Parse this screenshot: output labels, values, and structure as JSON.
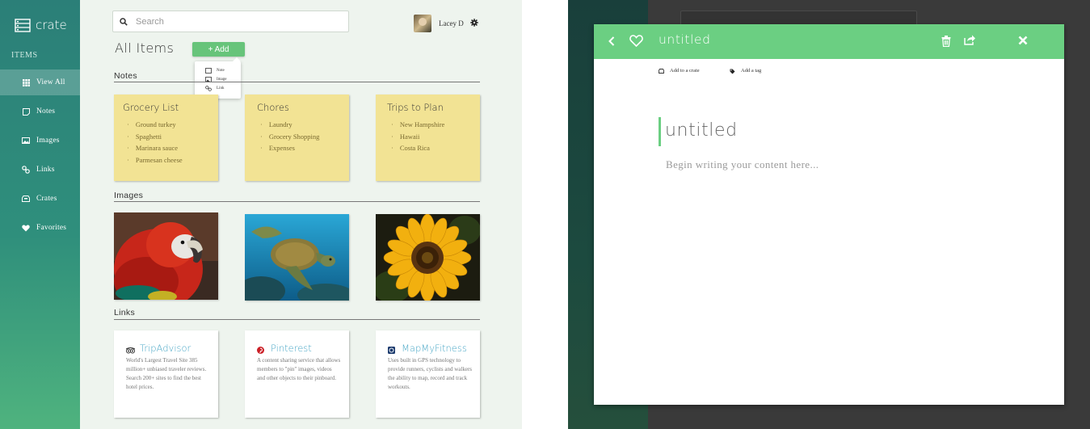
{
  "app": {
    "brand": "crate"
  },
  "sidebar": {
    "heading": "ITEMS",
    "items": [
      {
        "label": "View All",
        "icon": "grid-icon",
        "active": true
      },
      {
        "label": "Notes",
        "icon": "note-icon"
      },
      {
        "label": "Images",
        "icon": "image-icon"
      },
      {
        "label": "Links",
        "icon": "link-icon"
      },
      {
        "label": "Crates",
        "icon": "crate-icon"
      },
      {
        "label": "Favorites",
        "icon": "heart-icon"
      }
    ]
  },
  "search": {
    "placeholder": "Search"
  },
  "user": {
    "name": "Lacey D"
  },
  "main": {
    "title": "All Items",
    "add_label": "+ Add",
    "add_menu": [
      "Note",
      "Image",
      "Link"
    ],
    "sections": {
      "notes": "Notes",
      "images": "Images",
      "links": "Links"
    },
    "notes": [
      {
        "title": "Grocery List",
        "items": [
          "Ground turkey",
          "Spaghetti",
          "Marinara sauce",
          "Parmesan cheese"
        ]
      },
      {
        "title": "Chores",
        "items": [
          "Laundry",
          "Grocery Shopping",
          "Expenses"
        ]
      },
      {
        "title": "Trips to Plan",
        "items": [
          "New Hampshire",
          "Hawaii",
          "Costa Rica"
        ]
      }
    ],
    "images": [
      {
        "subject": "parrot"
      },
      {
        "subject": "sea turtle"
      },
      {
        "subject": "sunflower"
      }
    ],
    "links": [
      {
        "title": "TripAdvisor",
        "icon": "owl-icon",
        "desc": "World's Largest Travel Site 385 million+ unbiased traveler reviews. Search 200+ sites to find the best hotel prices."
      },
      {
        "title": "Pinterest",
        "icon": "pinterest-icon",
        "desc": "A content sharing service that allows members to \"pin\" images, videos and other objects to their pinboard."
      },
      {
        "title": "MapMyFitness",
        "icon": "mapmyfitness-icon",
        "desc": "Uses built in GPS technology to provide runners, cyclists and walkers the ability to map, record and track workouts."
      }
    ]
  },
  "modal": {
    "title": "untitled",
    "add_crate": "Add to a crate",
    "add_tag": "Add a tag",
    "editor_title": "untitled",
    "editor_placeholder": "Begin writing your content here..."
  },
  "colors": {
    "accent": "#6bcf82",
    "note": "#f2e394",
    "sidebar": "#2b7f78",
    "link": "#4ba8c7"
  }
}
